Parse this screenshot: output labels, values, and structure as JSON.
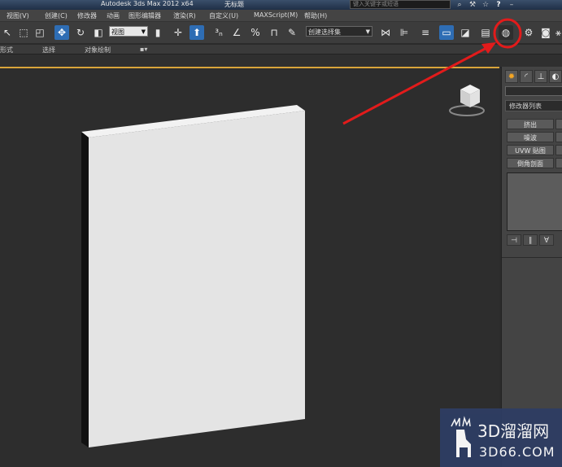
{
  "app": {
    "title": "Autodesk 3ds Max  2012 x64",
    "file": "无标题",
    "search_placeholder": "键入关键字或短语"
  },
  "menu": {
    "items": [
      "视图(V)",
      "创建(C)",
      "修改器",
      "动画",
      "图形编辑器",
      "渲染(R)",
      "自定义(U)",
      "MAXScript(M)",
      "帮助(H)"
    ]
  },
  "toolbar": {
    "view_dropdown": "视图",
    "selection_set_dropdown": "创建选择集"
  },
  "ribbon": {
    "items": [
      "形式",
      "选择",
      "对象绘制"
    ]
  },
  "command_panel": {
    "modifier_list": "修改器列表",
    "buttons": [
      "挤出",
      "噪波",
      "UVW 贴图",
      "倒角剖面"
    ]
  },
  "watermark": {
    "brand": "3D溜溜网",
    "url": "3D66.COM"
  },
  "colors": {
    "highlight": "#e21b1b",
    "accent": "#d9a43a",
    "active_tool": "#2e6db4"
  }
}
